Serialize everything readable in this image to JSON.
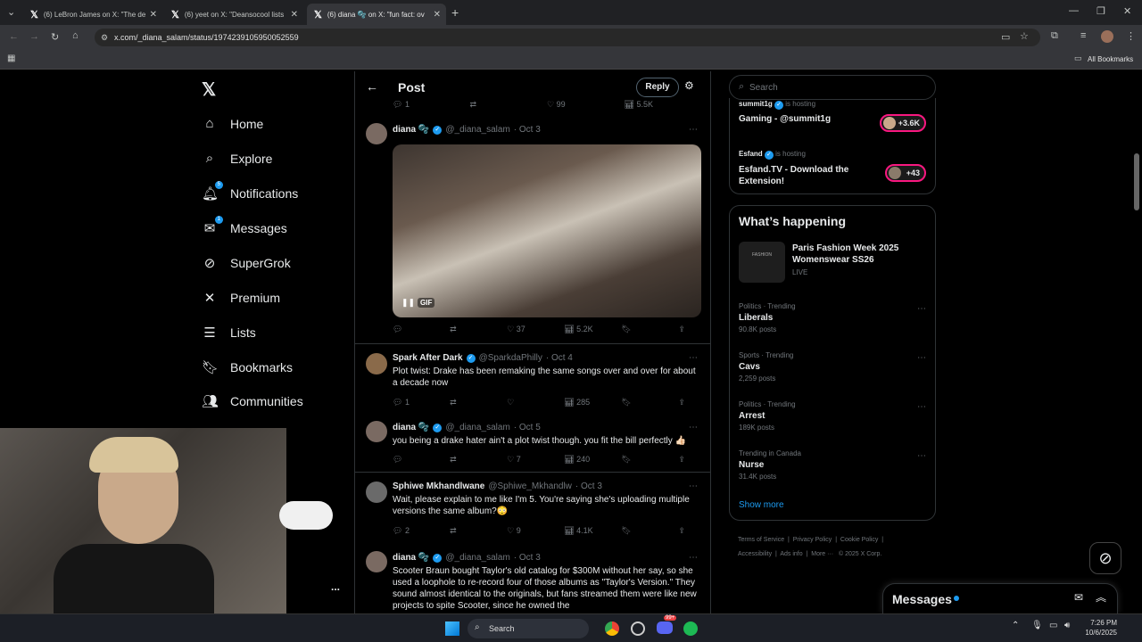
{
  "browser": {
    "tabs": [
      {
        "title": "(6) LeBron James on X: \"The de"
      },
      {
        "title": "(6) yeet on X: \"Deansocool lists"
      },
      {
        "title": "(6) diana 🫧 on X: \"fun fact: ov"
      }
    ],
    "url": "x.com/_diana_salam/status/1974239105950052559",
    "bookmarks_label": "All Bookmarks"
  },
  "nav": {
    "items": [
      {
        "label": "Home",
        "icon": "home-icon"
      },
      {
        "label": "Explore",
        "icon": "search-icon"
      },
      {
        "label": "Notifications",
        "icon": "bell-icon",
        "badge": "5"
      },
      {
        "label": "Messages",
        "icon": "mail-icon",
        "badge": "1"
      },
      {
        "label": "SuperGrok",
        "icon": "grok-icon"
      },
      {
        "label": "Premium",
        "icon": "x-icon"
      },
      {
        "label": "Lists",
        "icon": "list-icon"
      },
      {
        "label": "Bookmarks",
        "icon": "bookmark-icon"
      },
      {
        "label": "Communities",
        "icon": "communities-icon"
      }
    ],
    "more_label": "..."
  },
  "header": {
    "title": "Post",
    "reply_label": "Reply"
  },
  "top_stats": {
    "replies": "1",
    "likes": "99",
    "views": "5.5K"
  },
  "posts": [
    {
      "name": "diana 🫧",
      "handle": "@_diana_salam",
      "date": "· Oct 3",
      "text": "",
      "gif_label": "GIF",
      "replies": "",
      "reposts": "",
      "likes": "37",
      "views": "5.2K"
    },
    {
      "name": "Spark After Dark",
      "handle": "@SparkdaPhilly",
      "date": "· Oct 4",
      "text": "Plot twist: Drake has been remaking the same songs over and over for about a decade now",
      "replies": "1",
      "reposts": "",
      "likes": "",
      "views": "285"
    },
    {
      "name": "diana 🫧",
      "handle": "@_diana_salam",
      "date": "· Oct 5",
      "text": "you being a drake hater ain't a plot twist though. you fit the bill perfectly 👍🏻",
      "replies": "",
      "reposts": "",
      "likes": "7",
      "views": "240"
    },
    {
      "name": "Sphiwe Mkhandlwane",
      "handle": "@Sphiwe_Mkhandlw",
      "date": "· Oct 3",
      "text": "Wait, please explain to me like I'm 5. You're saying she's uploading multiple versions the same album?😳",
      "replies": "2",
      "reposts": "",
      "likes": "9",
      "views": "4.1K"
    },
    {
      "name": "diana 🫧",
      "handle": "@_diana_salam",
      "date": "· Oct 3",
      "text": "Scooter Braun bought Taylor's old catalog for $300M without her say, so she used a loophole to re-record four of those albums as \"Taylor's Version.\" They sound almost identical to the originals, but fans streamed them were like new projects to spite Scooter, since he owned the",
      "replies": "",
      "reposts": "",
      "likes": "",
      "views": ""
    }
  ],
  "search": {
    "placeholder": "Search"
  },
  "live": [
    {
      "host": "summit1g",
      "hosting_label": "is hosting",
      "title": "Gaming - @summit1g",
      "count": "+3.6K"
    },
    {
      "host": "Esfand",
      "hosting_label": "is hosting",
      "title": "Esfand.TV - Download the Extension!",
      "count": "+43"
    }
  ],
  "happening": {
    "title": "What’s happening",
    "featured": {
      "title": "Paris Fashion Week 2025 Womenswear SS26",
      "status": "LIVE",
      "thumb_text": "FASHION"
    },
    "trends": [
      {
        "meta": "Politics · Trending",
        "title": "Liberals",
        "count": "90.8K posts"
      },
      {
        "meta": "Sports · Trending",
        "title": "Cavs",
        "count": "2,259 posts"
      },
      {
        "meta": "Politics · Trending",
        "title": "Arrest",
        "count": "189K posts"
      },
      {
        "meta": "Trending in Canada",
        "title": "Nurse",
        "count": "31.4K posts"
      }
    ],
    "show_more": "Show more"
  },
  "footer": {
    "links": [
      "Terms of Service",
      "Privacy Policy",
      "Cookie Policy",
      "Accessibility",
      "Ads info",
      "More ···",
      "© 2025 X Corp."
    ]
  },
  "messages_drawer": {
    "label": "Messages"
  },
  "taskbar": {
    "search_label": "Search",
    "time": "7:26 PM",
    "date": "10/6/2025",
    "discord_badge": "99+"
  }
}
